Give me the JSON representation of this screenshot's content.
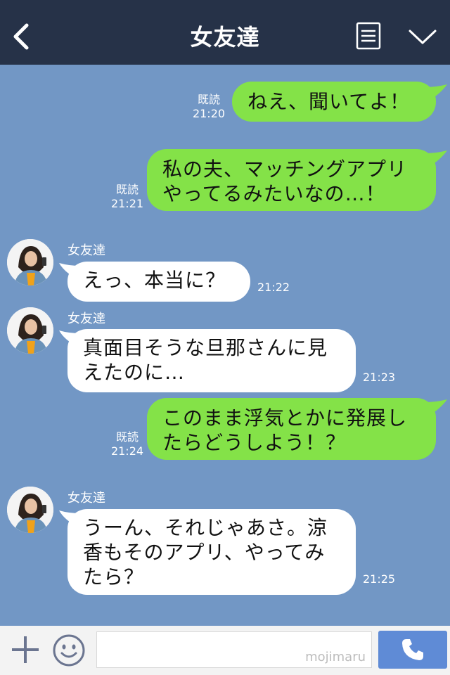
{
  "header": {
    "title": "女友達",
    "back_icon": "chevron-left-icon",
    "menu_icon": "notes-icon",
    "expand_icon": "chevron-down-icon"
  },
  "colors": {
    "header_bg": "#263248",
    "chat_bg": "#7297c5",
    "sent_bubble": "#84e248",
    "received_bubble": "#ffffff",
    "call_button": "#5f8bd6"
  },
  "messages": [
    {
      "direction": "sent",
      "text": "ねえ、聞いてよ！",
      "read_label": "既読",
      "time": "21:20"
    },
    {
      "direction": "sent",
      "text": "私の夫、マッチングアプリ\nやってるみたいなの…！",
      "read_label": "既読",
      "time": "21:21"
    },
    {
      "direction": "received",
      "sender": "女友達",
      "text": "えっ、本当に？",
      "time": "21:22"
    },
    {
      "direction": "received",
      "sender": "女友達",
      "text": "真面目そうな旦那さんに見\nえたのに…",
      "time": "21:23"
    },
    {
      "direction": "sent",
      "text": "このまま浮気とかに発展し\nたらどうしよう！？",
      "read_label": "既読",
      "time": "21:24"
    },
    {
      "direction": "received",
      "sender": "女友達",
      "text": "うーん、それじゃあさ。涼\n香もそのアプリ、やってみ\nたら？",
      "time": "21:25"
    }
  ],
  "footer": {
    "add_icon": "plus-icon",
    "sticker_icon": "smiley-icon",
    "input_value": "",
    "watermark": "mojimaru",
    "call_icon": "phone-icon"
  }
}
